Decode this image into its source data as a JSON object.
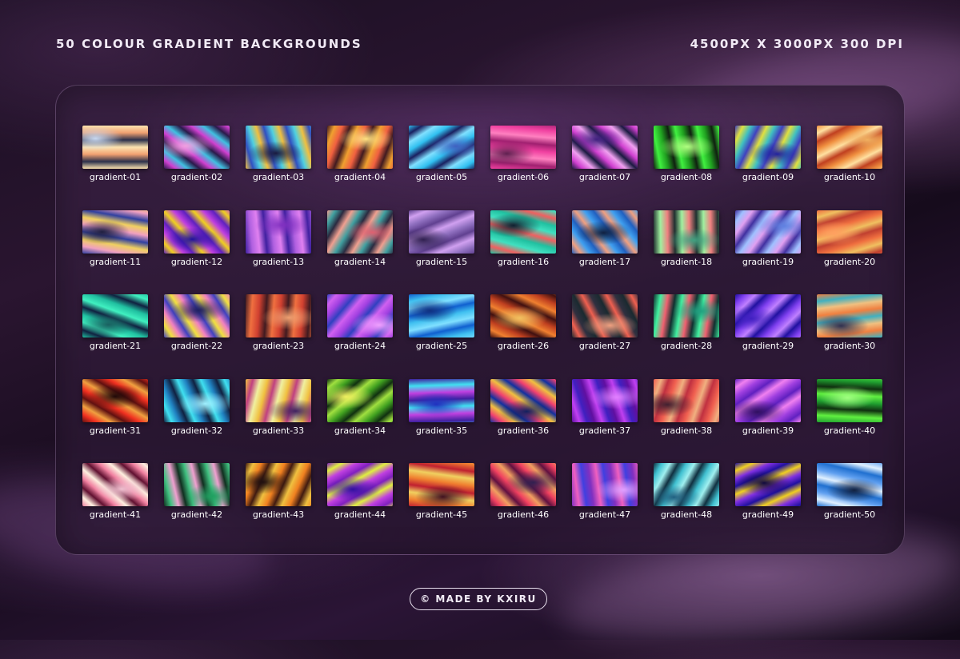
{
  "header": {
    "title": "50 COLOUR GRADIENT BACKGROUNDS",
    "specs": "4500PX X 3000PX 300 DPI"
  },
  "gradients": [
    {
      "label": "gradient-01",
      "colors": [
        "#fde3b0",
        "#2a2f4a",
        "#f0a070",
        "#c8d8f0"
      ]
    },
    {
      "label": "gradient-02",
      "colors": [
        "#2a1a4a",
        "#d040d0",
        "#40c0e0",
        "#f0a0e0"
      ]
    },
    {
      "label": "gradient-03",
      "colors": [
        "#f0c040",
        "#3050c0",
        "#50d0e0",
        "#1a1a40"
      ]
    },
    {
      "label": "gradient-04",
      "colors": [
        "#401a20",
        "#f0a030",
        "#f06040",
        "#ffe080"
      ]
    },
    {
      "label": "gradient-05",
      "colors": [
        "#30c0f0",
        "#1a2060",
        "#80e0ff",
        "#4060c0"
      ]
    },
    {
      "label": "gradient-06",
      "colors": [
        "#f040a0",
        "#a02070",
        "#ff80c0",
        "#602050"
      ]
    },
    {
      "label": "gradient-07",
      "colors": [
        "#1a1a40",
        "#d040d0",
        "#f0a0f0",
        "#402080"
      ]
    },
    {
      "label": "gradient-08",
      "colors": [
        "#102010",
        "#40f040",
        "#20a020",
        "#b0ff80"
      ]
    },
    {
      "label": "gradient-09",
      "colors": [
        "#4040c0",
        "#e0e040",
        "#40c0c0",
        "#2020a0"
      ]
    },
    {
      "label": "gradient-10",
      "colors": [
        "#f09040",
        "#ffe0a0",
        "#c04020",
        "#f0b060"
      ]
    },
    {
      "label": "gradient-11",
      "colors": [
        "#3040a0",
        "#f0a0c0",
        "#f0d060",
        "#202040"
      ]
    },
    {
      "label": "gradient-12",
      "colors": [
        "#6020c0",
        "#f0d020",
        "#c040e0",
        "#2010a0"
      ]
    },
    {
      "label": "gradient-13",
      "colors": [
        "#4020a0",
        "#b060e0",
        "#e080f0",
        "#8030c0"
      ]
    },
    {
      "label": "gradient-14",
      "colors": [
        "#f0a090",
        "#40a0a0",
        "#2a2a40",
        "#e06070"
      ]
    },
    {
      "label": "gradient-15",
      "colors": [
        "#604090",
        "#d0a0f0",
        "#9070c0",
        "#302050"
      ]
    },
    {
      "label": "gradient-16",
      "colors": [
        "#20c0a0",
        "#f06060",
        "#40e0c0",
        "#102030"
      ]
    },
    {
      "label": "gradient-17",
      "colors": [
        "#2060c0",
        "#f0a080",
        "#40a0f0",
        "#102040"
      ]
    },
    {
      "label": "gradient-18",
      "colors": [
        "#203030",
        "#a0f0a0",
        "#f08080",
        "#40a080"
      ]
    },
    {
      "label": "gradient-19",
      "colors": [
        "#4030a0",
        "#a0c0ff",
        "#e0a0f0",
        "#6080e0"
      ]
    },
    {
      "label": "gradient-20",
      "colors": [
        "#f07040",
        "#f0c060",
        "#c04030",
        "#ffa060"
      ]
    },
    {
      "label": "gradient-21",
      "colors": [
        "#20c0a0",
        "#102040",
        "#40f0c0",
        "#1a6060"
      ]
    },
    {
      "label": "gradient-22",
      "colors": [
        "#4040c0",
        "#f0e040",
        "#f080c0",
        "#202060"
      ]
    },
    {
      "label": "gradient-23",
      "colors": [
        "#401a20",
        "#f07040",
        "#d04030",
        "#f0a070"
      ]
    },
    {
      "label": "gradient-24",
      "colors": [
        "#3040c0",
        "#d060f0",
        "#a040e0",
        "#f0a0ff"
      ]
    },
    {
      "label": "gradient-25",
      "colors": [
        "#1060d0",
        "#40c0f0",
        "#80e0ff",
        "#103080"
      ]
    },
    {
      "label": "gradient-26",
      "colors": [
        "#401010",
        "#f08030",
        "#c04020",
        "#f0c060"
      ]
    },
    {
      "label": "gradient-27",
      "colors": [
        "#1a2a30",
        "#f06050",
        "#303040",
        "#f0a080"
      ]
    },
    {
      "label": "gradient-28",
      "colors": [
        "#103030",
        "#40f0a0",
        "#f06070",
        "#20a080"
      ]
    },
    {
      "label": "gradient-29",
      "colors": [
        "#2010a0",
        "#8040f0",
        "#c080ff",
        "#4020c0"
      ]
    },
    {
      "label": "gradient-30",
      "colors": [
        "#f08040",
        "#40b0c0",
        "#f0c080",
        "#303050"
      ]
    },
    {
      "label": "gradient-31",
      "colors": [
        "#601010",
        "#f03020",
        "#f0a040",
        "#200808"
      ]
    },
    {
      "label": "gradient-32",
      "colors": [
        "#102040",
        "#40e0f0",
        "#2080c0",
        "#a0f0ff"
      ]
    },
    {
      "label": "gradient-33",
      "colors": [
        "#f0c040",
        "#c04080",
        "#f0f0a0",
        "#402060"
      ]
    },
    {
      "label": "gradient-34",
      "colors": [
        "#103010",
        "#a0e040",
        "#40a020",
        "#f0f060"
      ]
    },
    {
      "label": "gradient-35",
      "colors": [
        "#4020a0",
        "#40e0f0",
        "#c040e0",
        "#2030c0"
      ]
    },
    {
      "label": "gradient-36",
      "colors": [
        "#1030a0",
        "#f04070",
        "#f0c040",
        "#102060"
      ]
    },
    {
      "label": "gradient-37",
      "colors": [
        "#6010a0",
        "#c040f0",
        "#4020c0",
        "#e080ff"
      ]
    },
    {
      "label": "gradient-38",
      "colors": [
        "#f06050",
        "#f0b080",
        "#c03040",
        "#402030"
      ]
    },
    {
      "label": "gradient-39",
      "colors": [
        "#6020c0",
        "#f080f0",
        "#a040e0",
        "#301060"
      ]
    },
    {
      "label": "gradient-40",
      "colors": [
        "#20a030",
        "#60f040",
        "#103010",
        "#a0ff80"
      ]
    },
    {
      "label": "gradient-41",
      "colors": [
        "#f080a0",
        "#fff0e0",
        "#601030",
        "#f0c0d0"
      ]
    },
    {
      "label": "gradient-42",
      "colors": [
        "#103020",
        "#40c080",
        "#f0a0d0",
        "#20a060"
      ]
    },
    {
      "label": "gradient-43",
      "colors": [
        "#401a10",
        "#f0c040",
        "#f08020",
        "#201010"
      ]
    },
    {
      "label": "gradient-44",
      "colors": [
        "#8020c0",
        "#e0f040",
        "#c040e0",
        "#3010a0"
      ]
    },
    {
      "label": "gradient-45",
      "colors": [
        "#c02030",
        "#f08030",
        "#f0d060",
        "#401020"
      ]
    },
    {
      "label": "gradient-46",
      "colors": [
        "#601040",
        "#f04060",
        "#f0a060",
        "#302050"
      ]
    },
    {
      "label": "gradient-47",
      "colors": [
        "#8030c0",
        "#f060c0",
        "#4040e0",
        "#e0a0ff"
      ]
    },
    {
      "label": "gradient-48",
      "colors": [
        "#103040",
        "#40c0d0",
        "#a0f0f0",
        "#206080"
      ]
    },
    {
      "label": "gradient-49",
      "colors": [
        "#2010a0",
        "#f0d020",
        "#8030e0",
        "#100840"
      ]
    },
    {
      "label": "gradient-50",
      "colors": [
        "#2070d0",
        "#e0f0ff",
        "#60a0f0",
        "#102040"
      ]
    }
  ],
  "footer": {
    "credit": "© MADE BY KXIRU"
  }
}
